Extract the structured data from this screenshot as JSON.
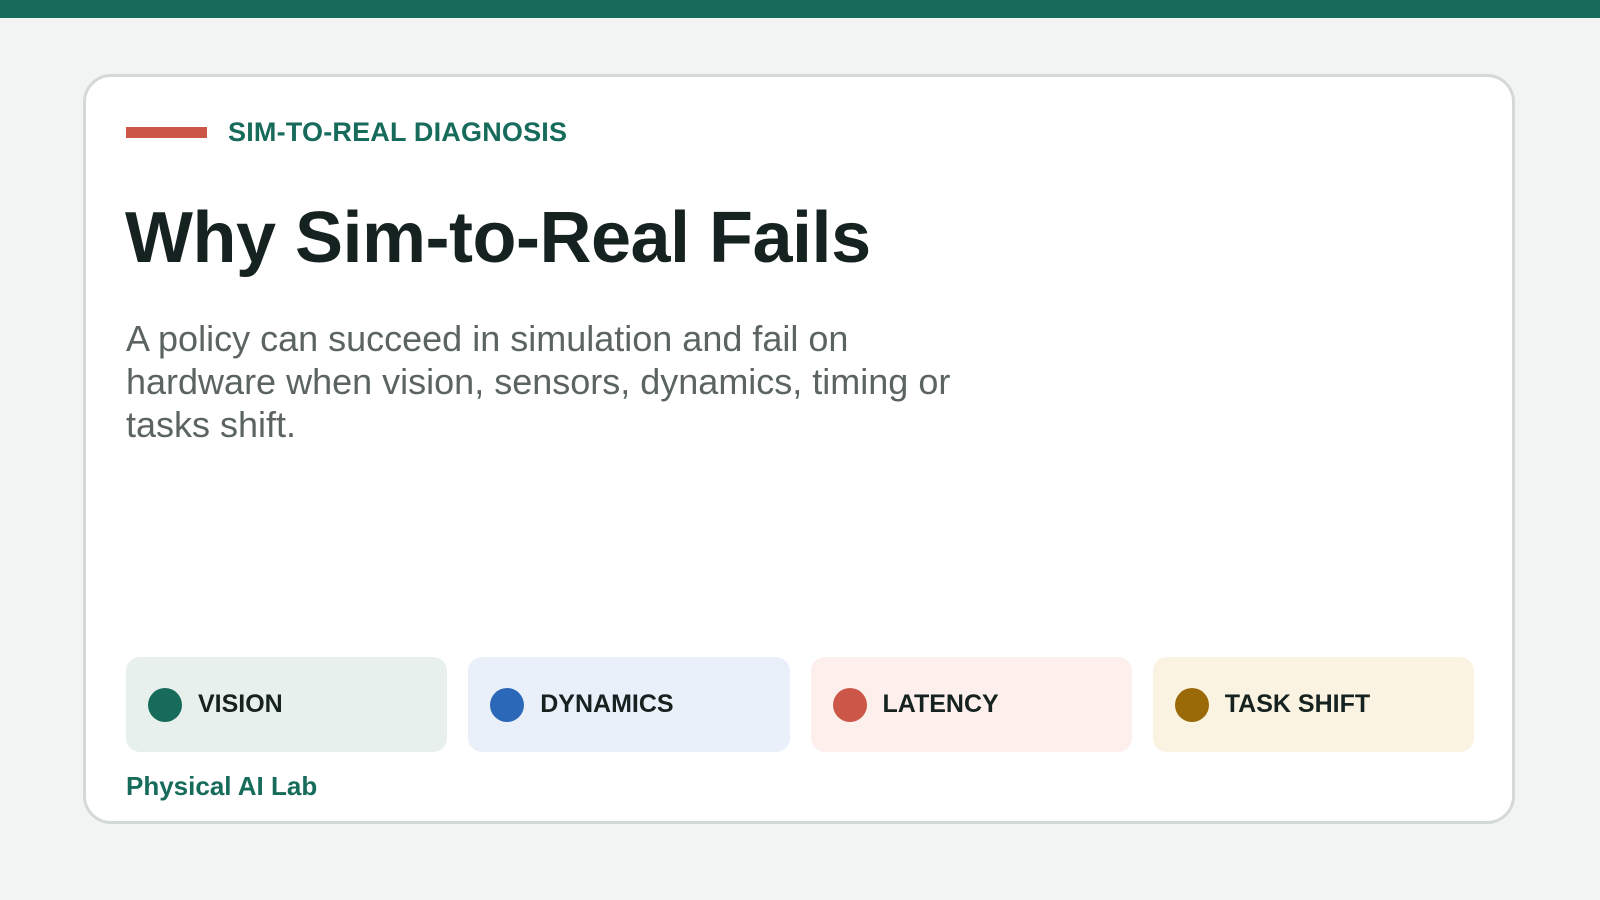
{
  "eyebrow": "SIM-TO-REAL DIAGNOSIS",
  "title": "Why Sim-to-Real Fails",
  "subtitle": "A policy can succeed in simulation and fail on hardware when vision, sensors, dynamics, timing or tasks shift.",
  "factors": [
    {
      "label": "VISION",
      "color": "#176b5a",
      "background": "#e7f0ed"
    },
    {
      "label": "DYNAMICS",
      "color": "#2b68b8",
      "background": "#e9f0f9"
    },
    {
      "label": "LATENCY",
      "color": "#cc5748",
      "background": "#fdefec"
    },
    {
      "label": "TASK SHIFT",
      "color": "#9a6a08",
      "background": "#fbf3e1"
    }
  ],
  "footer": "Physical AI Lab",
  "colors": {
    "accent": "#176b5a",
    "rule": "#cc5748",
    "background": "#f2f4f3"
  }
}
